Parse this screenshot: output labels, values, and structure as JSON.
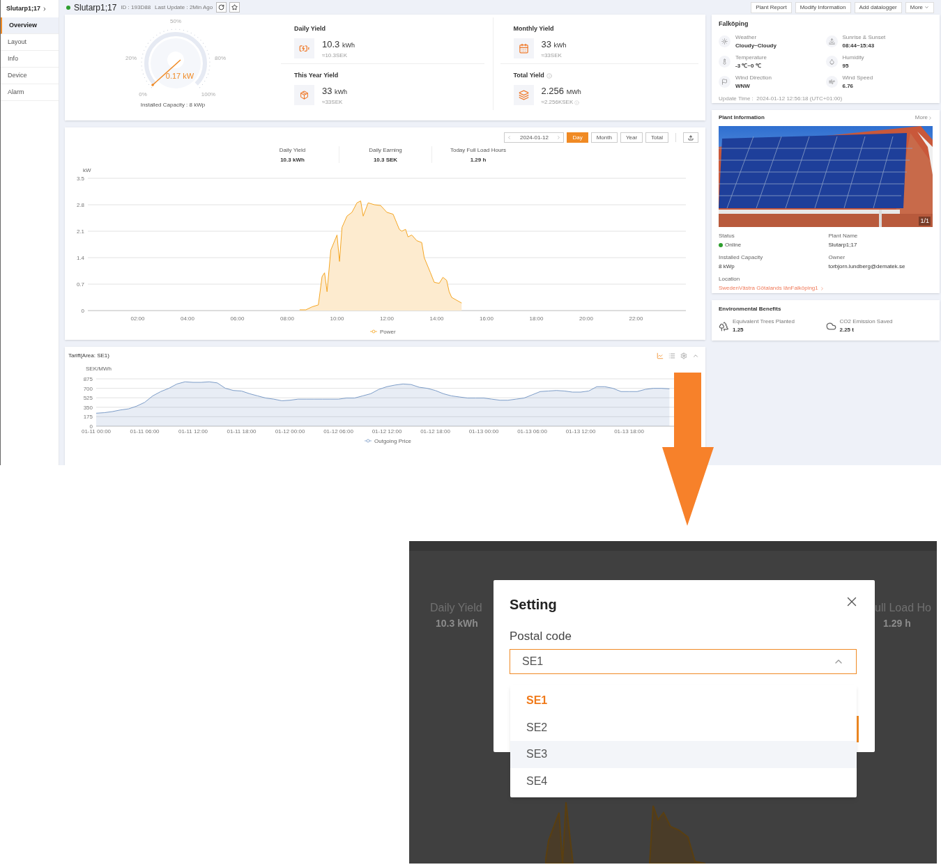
{
  "sidebar": {
    "title": "Slutarp1;17",
    "items": [
      {
        "label": "Overview",
        "selected": true
      },
      {
        "label": "Layout",
        "selected": false
      },
      {
        "label": "Info",
        "selected": false
      },
      {
        "label": "Device",
        "selected": false
      },
      {
        "label": "Alarm",
        "selected": false
      }
    ]
  },
  "header": {
    "plant_name": "Slutarp1;17",
    "id": "ID : 193D88",
    "last_update": "Last Update : 2Min Ago",
    "actions": [
      {
        "label": "Plant Report",
        "dropdown": false
      },
      {
        "label": "Modify Information",
        "dropdown": false
      },
      {
        "label": "Add datalogger",
        "dropdown": false
      },
      {
        "label": "More",
        "dropdown": true
      }
    ]
  },
  "gauge": {
    "reading": "0.17 kW",
    "tick_labels": [
      "0%",
      "20%",
      "50%",
      "80%",
      "100%"
    ],
    "capacity": "Installed Capacity : 8 kWp"
  },
  "yields": [
    {
      "kind": "daily",
      "title": "Daily Yield",
      "value": "10.3",
      "unit": "kWh",
      "earning": "≈10.3SEK",
      "title_info": false,
      "earning_info": false
    },
    {
      "kind": "monthly",
      "title": "Monthly Yield",
      "value": "33",
      "unit": "kWh",
      "earning": "≈33SEK",
      "title_info": false,
      "earning_info": false
    },
    {
      "kind": "year",
      "title": "This Year Yield",
      "value": "33",
      "unit": "kWh",
      "earning": "≈33SEK",
      "title_info": false,
      "earning_info": false
    },
    {
      "kind": "total",
      "title": "Total Yield",
      "value": "2.256",
      "unit": "MWh",
      "earning": "≈2.256KSEK",
      "title_info": true,
      "earning_info": true
    }
  ],
  "weather": {
    "city": "Falköping",
    "items": [
      {
        "kind": "weather",
        "label": "Weather",
        "value": "Cloudy~Cloudy"
      },
      {
        "kind": "sun",
        "label": "Sunrise & Sunset",
        "value": "08:44~15:43"
      },
      {
        "kind": "temperature",
        "label": "Temperature",
        "value": "-3 ℃~0 ℃"
      },
      {
        "kind": "humidity",
        "label": "Humidity",
        "value": "95"
      },
      {
        "kind": "wind_direction",
        "label": "Wind Direction",
        "value": "WNW"
      },
      {
        "kind": "wind_speed",
        "label": "Wind Speed",
        "value": "6.76"
      }
    ],
    "update_time": "Update Time :  2024-01-12 12:56:18 (UTC+01:00)"
  },
  "plant_info": {
    "title": "Plant Information",
    "more": "More",
    "image": {
      "kind": "picture",
      "counter": "1/1"
    },
    "fields": [
      {
        "kind": "status",
        "label": "Status",
        "value": "Online",
        "color": "#2e9e2e"
      },
      {
        "kind": "text",
        "label": "Plant Name",
        "value": "Slutarp1;17"
      },
      {
        "kind": "text",
        "label": "Installed Capacity",
        "value": "8 kWp"
      },
      {
        "kind": "text",
        "label": "Owner",
        "value": "torbjorn.lundberg@dematek.se"
      },
      {
        "kind": "link",
        "label": "Location",
        "value": "SwedenVästra Götalands länFalköping1"
      }
    ]
  },
  "environment": {
    "title": "Environmental Benefits",
    "items": [
      {
        "kind": "trees",
        "label": "Equivalent Trees Planted",
        "value": "1.25"
      },
      {
        "kind": "co2",
        "label": "CO2 Emission Saved",
        "value": "2.25 t"
      }
    ]
  },
  "power": {
    "date": "2024-01-12",
    "ranges": [
      {
        "label": "Day",
        "selected": true
      },
      {
        "label": "Month",
        "selected": false
      },
      {
        "label": "Year",
        "selected": false
      },
      {
        "label": "Total",
        "selected": false
      }
    ],
    "summary": [
      {
        "label": "Daily Yield",
        "value": "10.3 kWh"
      },
      {
        "label": "Daily Earning",
        "value": "10.3 SEK"
      },
      {
        "label": "Today Full Load Hours",
        "value": "1.29 h"
      }
    ],
    "chart_data": {
      "type": "area",
      "grid": true,
      "ylabel": "kW",
      "xlim": [
        0,
        24
      ],
      "ylim": [
        0,
        3.5
      ],
      "yticks": [
        0,
        0.7,
        1.4,
        2.1,
        2.8,
        3.5
      ],
      "xticks": [
        {
          "value": 2,
          "label": "02:00"
        },
        {
          "value": 4,
          "label": "04:00"
        },
        {
          "value": 6,
          "label": "06:00"
        },
        {
          "value": 8,
          "label": "08:00"
        },
        {
          "value": 10,
          "label": "10:00"
        },
        {
          "value": 12,
          "label": "12:00"
        },
        {
          "value": 14,
          "label": "14:00"
        },
        {
          "value": 16,
          "label": "16:00"
        },
        {
          "value": 18,
          "label": "18:00"
        },
        {
          "value": 20,
          "label": "20:00"
        },
        {
          "value": 22,
          "label": "22:00"
        }
      ],
      "x": [
        8.5,
        8.75,
        9,
        9.25,
        9.4,
        9.5,
        9.6,
        9.75,
        10,
        10.1,
        10.2,
        10.4,
        10.6,
        10.8,
        10.95,
        11.05,
        11.25,
        11.5,
        11.75,
        12,
        12.25,
        12.5,
        12.6,
        12.75,
        12.85,
        13,
        13.2,
        13.4,
        13.5,
        13.75,
        13.9,
        14.1,
        14.25,
        14.4,
        14.5,
        14.6,
        15
      ],
      "series": [
        {
          "name": "Power",
          "color": "#f5a623",
          "values": [
            0.02,
            0.02,
            0.1,
            0.15,
            0.9,
            1.0,
            0.5,
            1.6,
            2.0,
            1.3,
            2.2,
            2.5,
            2.6,
            2.85,
            2.9,
            2.5,
            2.85,
            2.8,
            2.78,
            2.6,
            2.55,
            2.15,
            2.1,
            2.15,
            1.95,
            2.0,
            1.85,
            1.8,
            1.4,
            1.0,
            0.75,
            0.72,
            0.88,
            0.8,
            0.5,
            0.35,
            0.2
          ]
        }
      ]
    }
  },
  "tariff": {
    "title": "Tariff(Area: SE1)",
    "tools": [
      {
        "kind": "chart",
        "selected": true
      },
      {
        "kind": "list",
        "selected": false
      },
      {
        "kind": "settings",
        "selected": false
      },
      {
        "kind": "collapse",
        "selected": false
      }
    ],
    "chart_data": {
      "type": "area",
      "grid": true,
      "ylabel": "SEK/MWh",
      "ylim": [
        0,
        875
      ],
      "yticks": [
        0,
        175,
        350,
        525,
        700,
        875
      ],
      "categories": [
        "01-11 00:00",
        null,
        null,
        null,
        null,
        null,
        "01-11 06:00",
        null,
        null,
        null,
        null,
        null,
        "01-11 12:00",
        null,
        null,
        null,
        null,
        null,
        "01-11 18:00",
        null,
        null,
        null,
        null,
        null,
        "01-12 00:00",
        null,
        null,
        null,
        null,
        null,
        "01-12 06:00",
        null,
        null,
        null,
        null,
        null,
        "01-12 12:00",
        null,
        null,
        null,
        null,
        null,
        "01-12 18:00",
        null,
        null,
        null,
        null,
        null,
        "01-13 00:00",
        null,
        null,
        null,
        null,
        null,
        "01-13 06:00",
        null,
        null,
        null,
        null,
        null,
        "01-13 12:00",
        null,
        null,
        null,
        null,
        null,
        "01-13 18:00",
        null,
        null,
        null,
        null,
        null
      ],
      "series": [
        {
          "name": "Outgoing Price",
          "color": "#7d9dc8",
          "values": [
            240,
            250,
            270,
            300,
            320,
            370,
            440,
            560,
            640,
            700,
            780,
            820,
            810,
            810,
            820,
            800,
            700,
            660,
            650,
            600,
            560,
            520,
            500,
            470,
            480,
            500,
            500,
            500,
            500,
            500,
            500,
            520,
            520,
            560,
            600,
            680,
            730,
            760,
            780,
            770,
            720,
            700,
            660,
            600,
            560,
            540,
            520,
            520,
            520,
            500,
            480,
            480,
            500,
            520,
            580,
            640,
            650,
            660,
            650,
            630,
            630,
            650,
            730,
            730,
            700,
            640,
            640,
            640,
            680,
            700,
            700,
            690
          ]
        }
      ]
    }
  },
  "setting_dialog": {
    "backdrop": {
      "left_label": "Daily Yield",
      "left_value": "10.3 kWh",
      "right_label": "ull Load Ho",
      "right_value": "1.29 h"
    },
    "title": "Setting",
    "field_label": "Postal code",
    "value": "SE1",
    "expanded": true,
    "options": [
      {
        "label": "SE1",
        "selected": true,
        "hovered": false
      },
      {
        "label": "SE2",
        "selected": false,
        "hovered": false
      },
      {
        "label": "SE3",
        "selected": false,
        "hovered": true
      },
      {
        "label": "SE4",
        "selected": false,
        "hovered": false
      }
    ]
  }
}
